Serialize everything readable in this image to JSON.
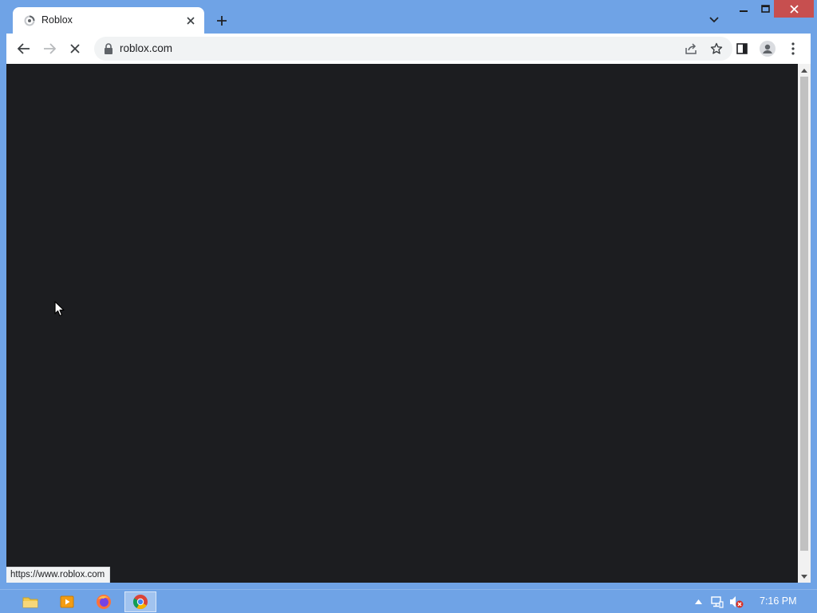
{
  "browser": {
    "tab": {
      "title": "Roblox",
      "favicon": "loading-spinner-icon"
    },
    "new_tab_icon": "plus-icon",
    "tab_search_icon": "chevron-down-icon",
    "window_controls": {
      "minimize": "minimize-icon",
      "maximize": "maximize-icon",
      "close": "close-icon"
    },
    "toolbar": {
      "back": "arrow-left-icon",
      "forward": "arrow-right-icon",
      "stop": "close-icon",
      "url": "roblox.com",
      "share": "share-icon",
      "bookmark": "star-icon",
      "side_panel": "side-panel-icon",
      "profile": "avatar-icon",
      "menu": "kebab-menu-icon"
    },
    "status_bubble": "https://www.roblox.com"
  },
  "colors": {
    "frame": "#6fa3e6",
    "content": "#1c1d20",
    "close_button": "#c74f4f"
  },
  "taskbar": {
    "apps": [
      {
        "name": "File Explorer",
        "icon": "folder-icon"
      },
      {
        "name": "Media Player",
        "icon": "media-player-icon"
      },
      {
        "name": "Firefox",
        "icon": "firefox-icon"
      },
      {
        "name": "Chrome",
        "icon": "chrome-icon",
        "active": true
      }
    ],
    "tray": [
      "chevron-up-icon",
      "network-icon",
      "volume-muted-icon"
    ],
    "clock": "7:16 PM"
  }
}
